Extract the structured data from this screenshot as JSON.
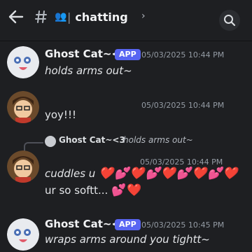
{
  "header": {
    "channel_icon": "hash-icon",
    "channel_emoji": "👥",
    "separator": "|",
    "channel_name": "chatting",
    "chevron": "›"
  },
  "messages": [
    {
      "author": "Ghost Cat~<3",
      "badge": "APP",
      "timestamp": "05/03/2025 10:44 PM",
      "text": "holds arms out~"
    },
    {
      "timestamp": "05/03/2025 10:44 PM",
      "text": "yoy!!!"
    },
    {
      "reply_author": "Ghost Cat~<3",
      "reply_text": "holds arms out~",
      "timestamp": "05/03/2025 10:44 PM",
      "text_line1": "cuddles u",
      "hearts": "❤️💕❤️💕❤️💕❤️💕❤️",
      "text_line2": "ur so softt... ",
      "text_line2_suffix": "💕❤️"
    },
    {
      "author": "Ghost Cat~<3",
      "badge": "APP",
      "timestamp": "05/03/2025 10:45 PM",
      "text": "wraps arms around you tightt~"
    }
  ],
  "colors": {
    "background": "#1e1f22",
    "app_badge": "#5865f2",
    "heart": "#e23645"
  }
}
